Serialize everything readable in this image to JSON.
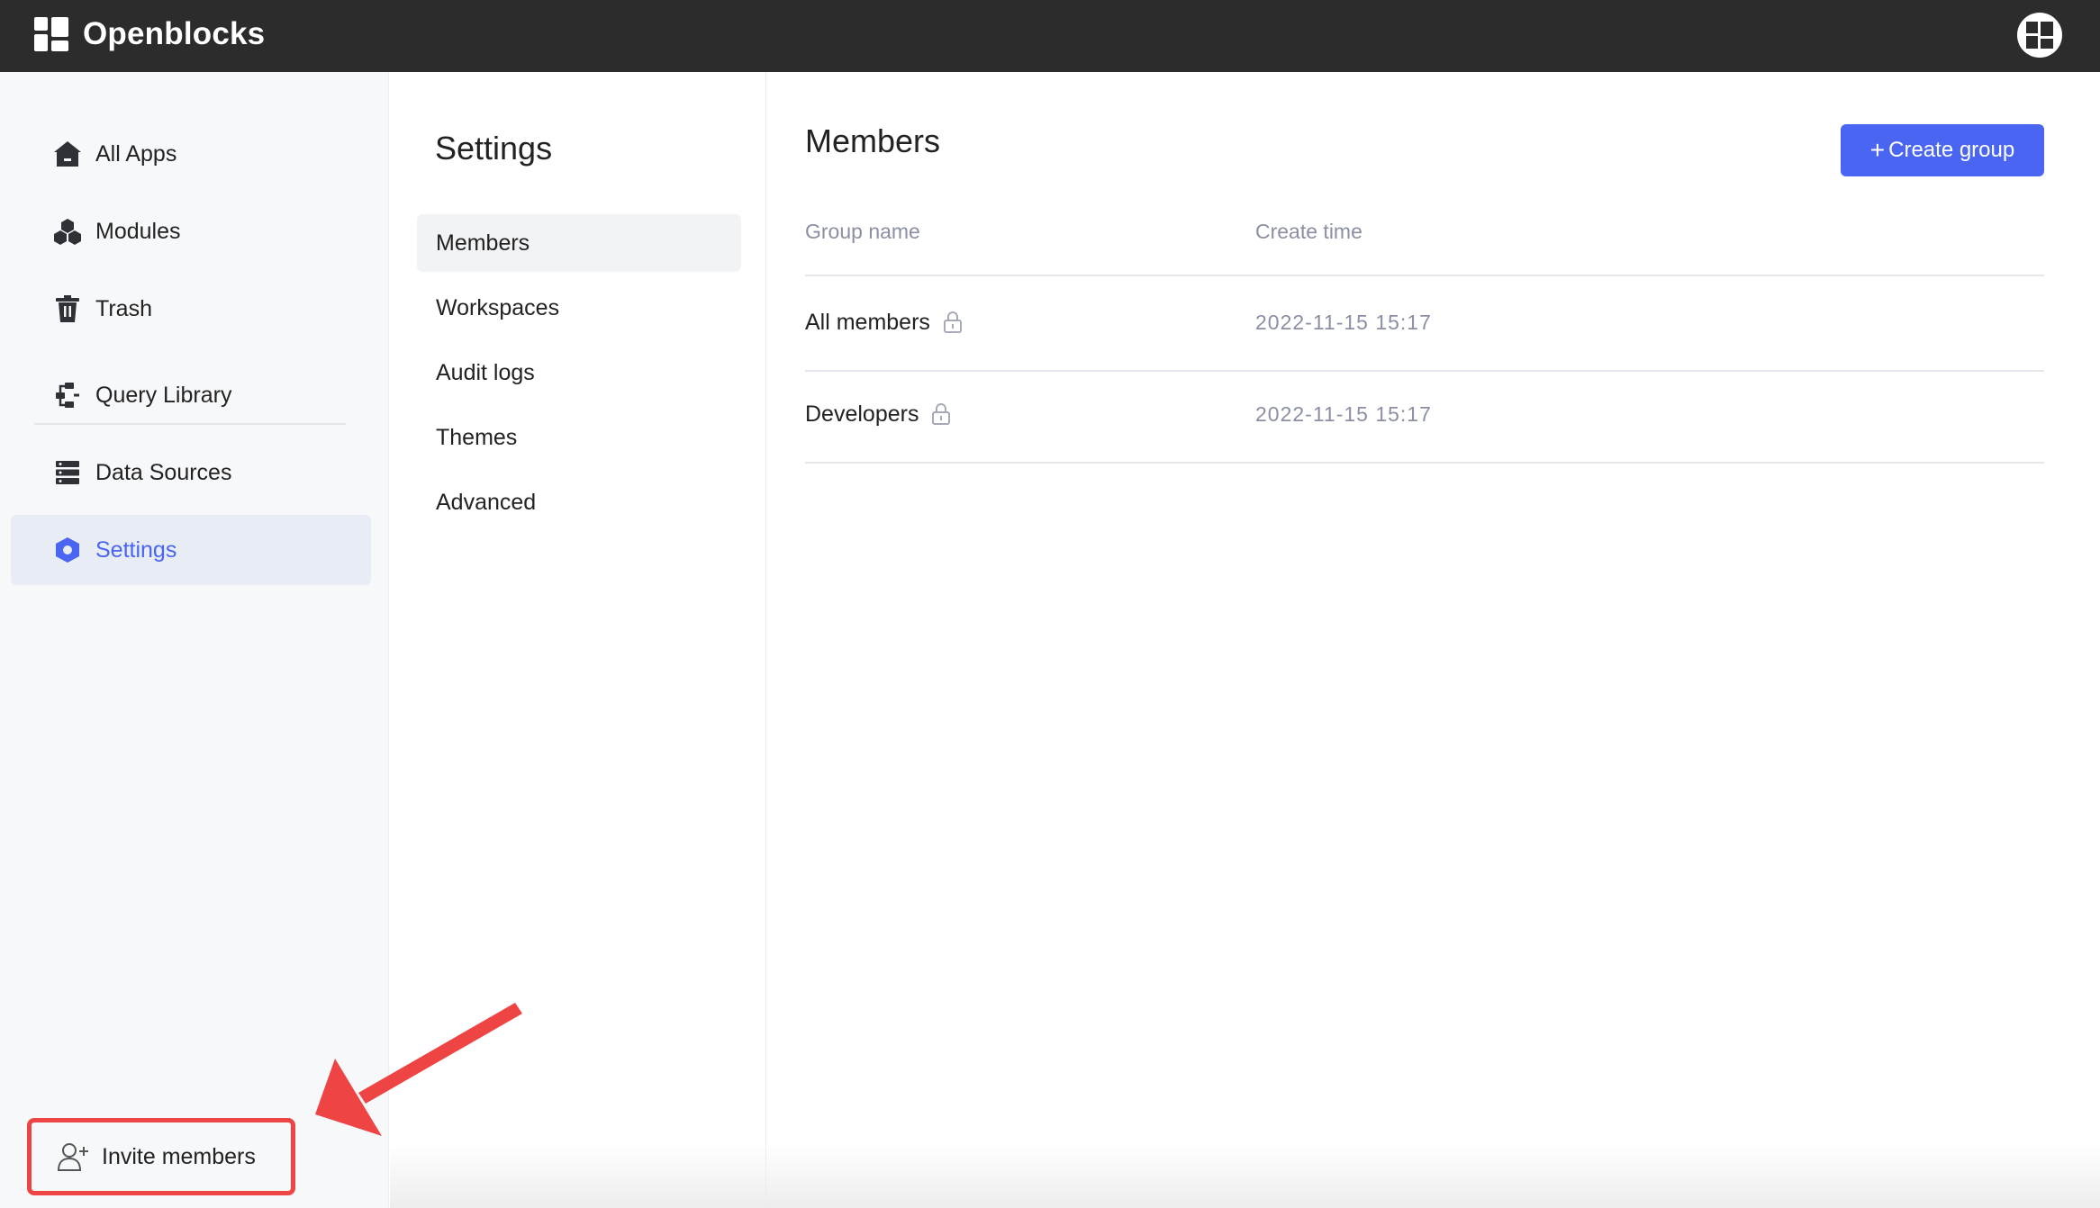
{
  "app": {
    "name": "Openblocks"
  },
  "sidebar": {
    "items": [
      {
        "label": "All Apps",
        "icon": "home-icon"
      },
      {
        "label": "Modules",
        "icon": "modules-icon"
      },
      {
        "label": "Trash",
        "icon": "trash-icon"
      },
      {
        "label": "Query Library",
        "icon": "query-library-icon"
      },
      {
        "label": "Data Sources",
        "icon": "data-sources-icon"
      },
      {
        "label": "Settings",
        "icon": "settings-hexagon-icon",
        "active": true
      }
    ],
    "invite_label": "Invite members"
  },
  "settings_nav": {
    "title": "Settings",
    "items": [
      {
        "label": "Members",
        "active": true
      },
      {
        "label": "Workspaces"
      },
      {
        "label": "Audit logs"
      },
      {
        "label": "Themes"
      },
      {
        "label": "Advanced"
      }
    ]
  },
  "members": {
    "title": "Members",
    "create_button": "Create group",
    "columns": [
      "Group name",
      "Create time"
    ],
    "rows": [
      {
        "name": "All members",
        "create_time": "2022-11-15 15:17",
        "locked": true
      },
      {
        "name": "Developers",
        "create_time": "2022-11-15 15:17",
        "locked": true
      }
    ]
  },
  "colors": {
    "topbar": "#2c2c2c",
    "accent": "#4965f2",
    "highlight_box": "#ef4444",
    "muted_text": "#8b8fa3"
  }
}
